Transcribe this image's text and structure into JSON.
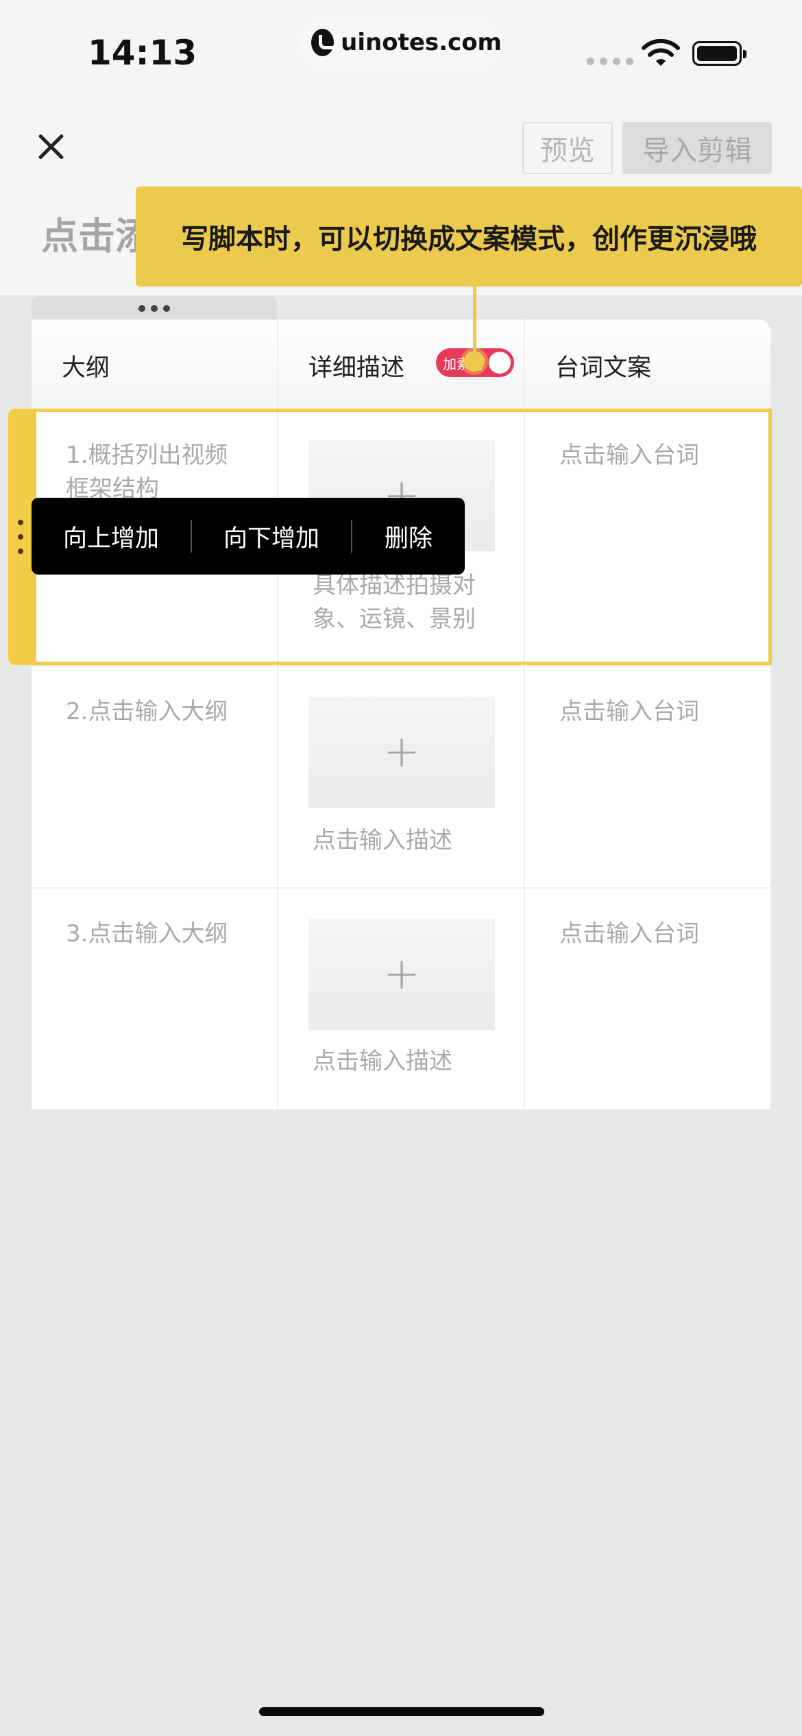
{
  "status_bar": {
    "time": "14:13",
    "url": "uinotes.com",
    "icons": [
      "wifi-icon",
      "battery-icon"
    ]
  },
  "header": {
    "close_icon": "close-icon",
    "preview_label": "预览",
    "import_label": "导入剪辑",
    "title_placeholder": "点击添"
  },
  "tooltip": {
    "text": "写脚本时，可以切换成文案模式，创作更沉浸哦"
  },
  "table": {
    "columns": [
      {
        "label": "大纲"
      },
      {
        "label": "详细描述",
        "toggle_label": "加素材"
      },
      {
        "label": "台词文案"
      }
    ],
    "rows": [
      {
        "outline": "1.概括列出视频框架结构",
        "description": "具体描述拍摄对象、运镜、景别",
        "script": "点击输入台词"
      },
      {
        "outline": "2.点击输入大纲",
        "description": "点击输入描述",
        "script": "点击输入台词"
      },
      {
        "outline": "3.点击输入大纲",
        "description": "点击输入描述",
        "script": "点击输入台词"
      }
    ],
    "add_symbol": "+"
  },
  "context_menu": {
    "items": [
      "向上增加",
      "向下增加",
      "删除"
    ]
  },
  "colors": {
    "accent_yellow": "#ecca4d",
    "toggle_red": "#e6395c",
    "menu_bg": "#000000"
  }
}
